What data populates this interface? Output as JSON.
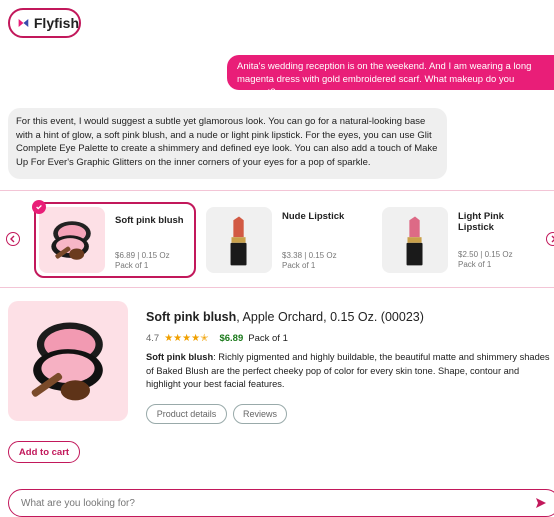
{
  "app": {
    "logo_text": "Flyfish"
  },
  "chat": {
    "user_message": "Anita's wedding reception is on the weekend. And I am wearing a long magenta dress with gold embroidered scarf. What makeup do you suggest?",
    "bot_message": "For this event, I would suggest a subtle yet glamorous look. You can go for a natural-looking base with a hint of glow, a soft pink blush, and a nude or light pink lipstick. For the eyes, you can use Glit Complete Eye Palette to create a shimmery and defined eye look. You can also add a touch of Make Up For Ever's Graphic Glitters on the inner corners of your eyes for a pop of sparkle."
  },
  "products": [
    {
      "name": "Soft pink blush",
      "price": "$6.89",
      "size": "0.15 Oz",
      "pack": "Pack of 1",
      "selected": true,
      "icon": "blush-compact-icon"
    },
    {
      "name": "Nude Lipstick",
      "price": "$3.38",
      "size": "0.15 Oz",
      "pack": "Pack of 1",
      "selected": false,
      "icon": "lipstick-icon"
    },
    {
      "name": "Light Pink Lipstick",
      "price": "$2.50",
      "size": "0.15 Oz",
      "pack": "Pack of 1",
      "selected": false,
      "icon": "lipstick-icon"
    }
  ],
  "detail": {
    "name": "Soft pink blush",
    "subtitle": ", Apple Orchard, 0.15 Oz. (00023)",
    "rating": "4.7",
    "rating_value": 4.7,
    "price": "$6.89",
    "pack": "Pack of 1",
    "desc_name": "Soft pink blush",
    "description": ": Richly pigmented and highly buildable, the beautiful matte and shimmery shades of Baked Blush are the perfect cheeky pop of color for every skin tone. Shape, contour and highlight your best facial features.",
    "tabs": [
      "Product details",
      "Reviews"
    ],
    "add_to_cart": "Add to cart"
  },
  "search": {
    "placeholder": "What are you looking for?"
  },
  "colors": {
    "accent": "#c2185b",
    "user_bubble": "#e91e78",
    "price": "#1b7a1b",
    "star": "#f0a000"
  }
}
